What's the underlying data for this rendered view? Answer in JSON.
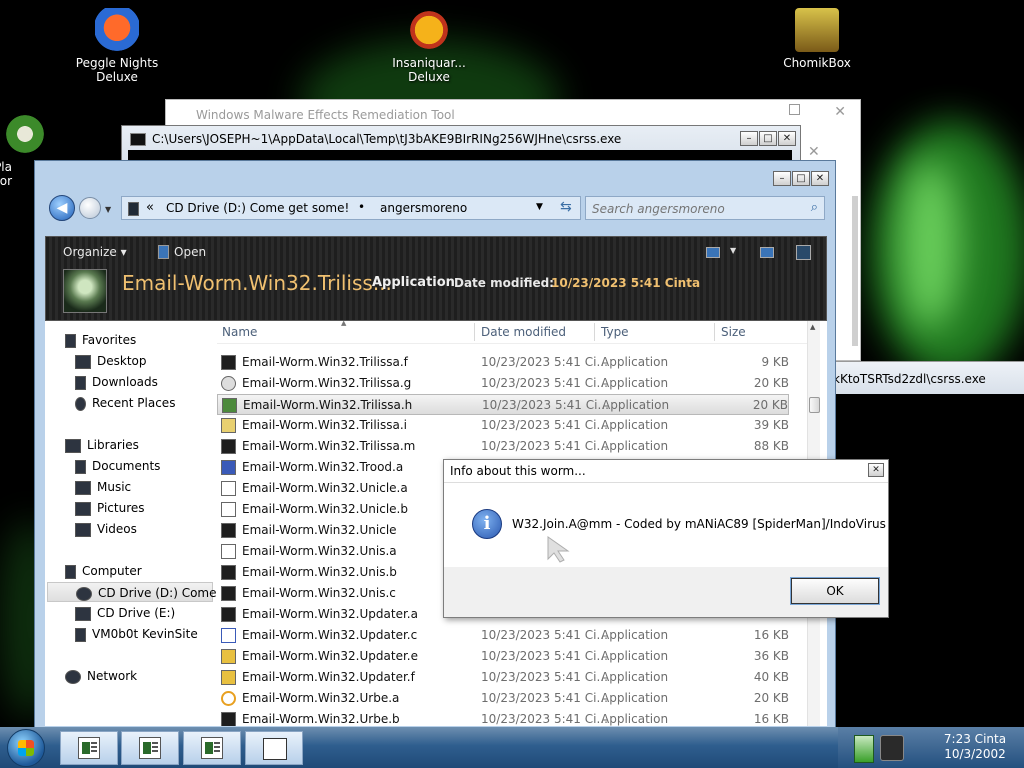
{
  "desktop": {
    "icons": [
      {
        "label": "Peggle Nights\nDeluxe"
      },
      {
        "label": "Insaniquar...\nDeluxe"
      },
      {
        "label": "ChomikBox"
      },
      {
        "label": "Pla\nZor"
      }
    ]
  },
  "malware_tool": {
    "title": "Windows Malware Effects Remediation Tool"
  },
  "console1": {
    "title": "C:\\Users\\JOSEPH~1\\AppData\\Local\\Temp\\tJ3bAKE9BIrRINg256WJHne\\csrss.exe"
  },
  "console2": {
    "title_fragment": "kKtoTSRTsd2zdl\\csrss.exe"
  },
  "explorer": {
    "breadcrumb": {
      "back_arrow": "«",
      "segment1": "CD Drive (D:) Come get some!",
      "separator": "•",
      "segment2": "angersmoreno"
    },
    "search_placeholder": "Search angersmoreno",
    "toolbar": {
      "organize": "Organize ▾",
      "open": "Open"
    },
    "details": {
      "title": "Email-Worm.Win32.Triliss...",
      "type": "Application",
      "date_label": "Date modified:",
      "date_value": "10/23/2023 5:41 Cinta"
    },
    "columns": {
      "name": "Name",
      "date": "Date modified",
      "type": "Type",
      "size": "Size"
    },
    "nav": {
      "favorites": "Favorites",
      "desktop": "Desktop",
      "downloads": "Downloads",
      "recent": "Recent Places",
      "libraries": "Libraries",
      "documents": "Documents",
      "music": "Music",
      "pictures": "Pictures",
      "videos": "Videos",
      "computer": "Computer",
      "cd_d": "CD Drive (D:) Come",
      "cd_e": "CD Drive (E:)",
      "vm": "VM0b0t KevinSite",
      "network": "Network"
    },
    "files": [
      {
        "name": "Email-Worm.Win32.Trilissa.f",
        "date": "10/23/2023 5:41 Ci...",
        "type": "Application",
        "size": "9 KB"
      },
      {
        "name": "Email-Worm.Win32.Trilissa.g",
        "date": "10/23/2023 5:41 Ci...",
        "type": "Application",
        "size": "20 KB"
      },
      {
        "name": "Email-Worm.Win32.Trilissa.h",
        "date": "10/23/2023 5:41 Ci...",
        "type": "Application",
        "size": "20 KB"
      },
      {
        "name": "Email-Worm.Win32.Trilissa.i",
        "date": "10/23/2023 5:41 Ci...",
        "type": "Application",
        "size": "39 KB"
      },
      {
        "name": "Email-Worm.Win32.Trilissa.m",
        "date": "10/23/2023 5:41 Ci...",
        "type": "Application",
        "size": "88 KB"
      },
      {
        "name": "Email-Worm.Win32.Trood.a",
        "date": "",
        "type": "",
        "size": ""
      },
      {
        "name": "Email-Worm.Win32.Unicle.a",
        "date": "",
        "type": "",
        "size": ""
      },
      {
        "name": "Email-Worm.Win32.Unicle.b",
        "date": "",
        "type": "",
        "size": ""
      },
      {
        "name": "Email-Worm.Win32.Unicle",
        "date": "",
        "type": "",
        "size": ""
      },
      {
        "name": "Email-Worm.Win32.Unis.a",
        "date": "",
        "type": "",
        "size": ""
      },
      {
        "name": "Email-Worm.Win32.Unis.b",
        "date": "",
        "type": "",
        "size": ""
      },
      {
        "name": "Email-Worm.Win32.Unis.c",
        "date": "",
        "type": "",
        "size": ""
      },
      {
        "name": "Email-Worm.Win32.Updater.a",
        "date": "",
        "type": "",
        "size": ""
      },
      {
        "name": "Email-Worm.Win32.Updater.c",
        "date": "10/23/2023 5:41 Ci...",
        "type": "Application",
        "size": "16 KB"
      },
      {
        "name": "Email-Worm.Win32.Updater.e",
        "date": "10/23/2023 5:41 Ci...",
        "type": "Application",
        "size": "36 KB"
      },
      {
        "name": "Email-Worm.Win32.Updater.f",
        "date": "10/23/2023 5:41 Ci...",
        "type": "Application",
        "size": "40 KB"
      },
      {
        "name": "Email-Worm.Win32.Urbe.a",
        "date": "10/23/2023 5:41 Ci...",
        "type": "Application",
        "size": "20 KB"
      },
      {
        "name": "Email-Worm.Win32.Urbe.b",
        "date": "10/23/2023 5:41 Ci...",
        "type": "Application",
        "size": "16 KB"
      }
    ]
  },
  "dialog": {
    "title": "Info about this worm...",
    "message": "W32.Join.A@mm - Coded by mANiAC89 [SpiderMan]/IndoVirus",
    "ok": "OK"
  },
  "taskbar": {
    "time": "7:23 Cinta",
    "date": "10/3/2002"
  },
  "colors": {
    "explorer_chrome": "#b9d1ea",
    "details_title": "#f0c070",
    "taskbar": "#2f5e8e",
    "info_icon": "#2a58b0"
  }
}
